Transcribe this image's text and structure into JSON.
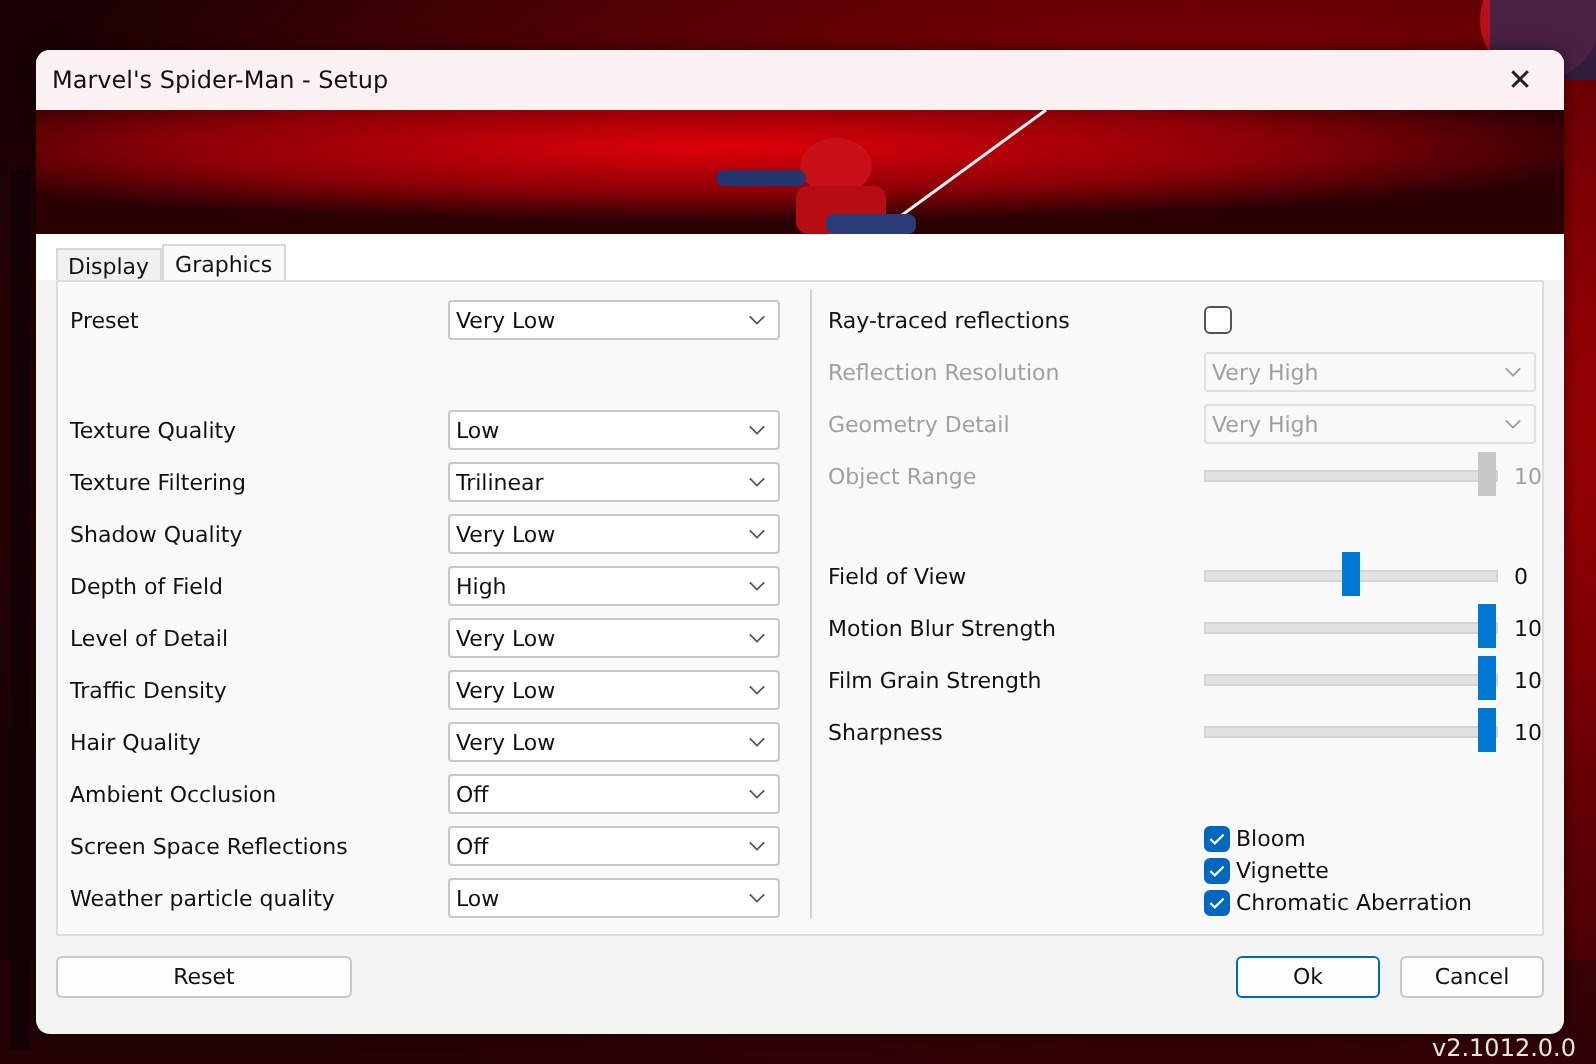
{
  "window": {
    "title": "Marvel's Spider-Man - Setup",
    "close": "✕"
  },
  "tabs": [
    {
      "label": "Display",
      "selected": false
    },
    {
      "label": "Graphics",
      "selected": true
    }
  ],
  "preset": {
    "label": "Preset",
    "value": "Very Low"
  },
  "settings": [
    {
      "label": "Texture Quality",
      "value": "Low"
    },
    {
      "label": "Texture Filtering",
      "value": "Trilinear"
    },
    {
      "label": "Shadow Quality",
      "value": "Very Low"
    },
    {
      "label": "Depth of Field",
      "value": "High"
    },
    {
      "label": "Level of Detail",
      "value": "Very Low"
    },
    {
      "label": "Traffic Density",
      "value": "Very Low"
    },
    {
      "label": "Hair Quality",
      "value": "Very Low"
    },
    {
      "label": "Ambient Occlusion",
      "value": "Off"
    },
    {
      "label": "Screen Space Reflections",
      "value": "Off"
    },
    {
      "label": "Weather particle quality",
      "value": "Low"
    }
  ],
  "ray_tracing": [
    {
      "kind": "checkbox",
      "label": "Ray-traced reflections",
      "checked": false,
      "disabled": false
    },
    {
      "kind": "combo",
      "label": "Reflection Resolution",
      "value": "Very High",
      "disabled": true
    },
    {
      "kind": "combo",
      "label": "Geometry Detail",
      "value": "Very High",
      "disabled": true
    },
    {
      "kind": "slider",
      "label": "Object Range",
      "level": 1,
      "reading": "10",
      "disabled": true
    }
  ],
  "sliders": [
    {
      "label": "Field of View",
      "level": 0.5,
      "reading": "0",
      "disabled": false
    },
    {
      "label": "Motion Blur Strength",
      "level": 1,
      "reading": "10",
      "disabled": false
    },
    {
      "label": "Film Grain Strength",
      "level": 1,
      "reading": "10",
      "disabled": false
    },
    {
      "label": "Sharpness",
      "level": 1,
      "reading": "10",
      "disabled": false
    }
  ],
  "effects": [
    {
      "label": "Bloom",
      "checked": true
    },
    {
      "label": "Vignette",
      "checked": true
    },
    {
      "label": "Chromatic Aberration",
      "checked": true
    }
  ],
  "buttons": {
    "reset": "Reset",
    "ok": "Ok",
    "cancel": "Cancel"
  },
  "version": "v2.1012.0.0"
}
